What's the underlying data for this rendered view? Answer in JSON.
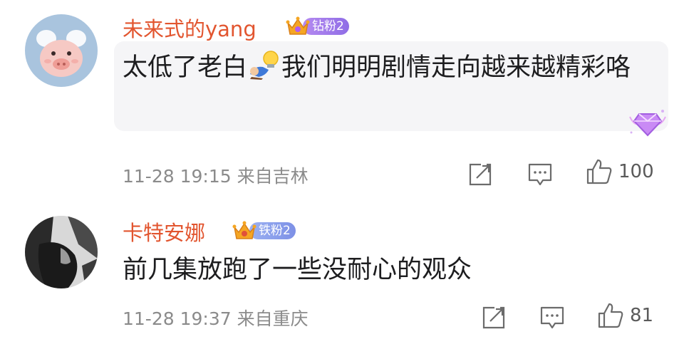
{
  "comments": [
    {
      "username": "未来式的yang",
      "fan_badge": "钻粉2",
      "text_before_emoji": "太低了老白",
      "text_after_emoji": "我们明明剧情走向越来越精彩咯",
      "inline_emoji": "idea-emoji",
      "meta": "11-28 19:15 来自吉林",
      "like_count": "100",
      "has_vip_badge": true
    },
    {
      "username": "卡特安娜",
      "fan_badge": "铁粉2",
      "text": "前几集放跑了一些没耐心的观众",
      "meta": "11-28 19:37 来自重庆",
      "like_count": "81"
    }
  ],
  "icons": {
    "repost": "repost-icon",
    "reply": "reply-icon",
    "like": "thumbs-up-icon",
    "crown": "crown-icon"
  },
  "colors": {
    "username": "#e2552f",
    "meta": "#8b8b8b",
    "text": "#1d1d1f",
    "icon": "#6b6b6b"
  }
}
